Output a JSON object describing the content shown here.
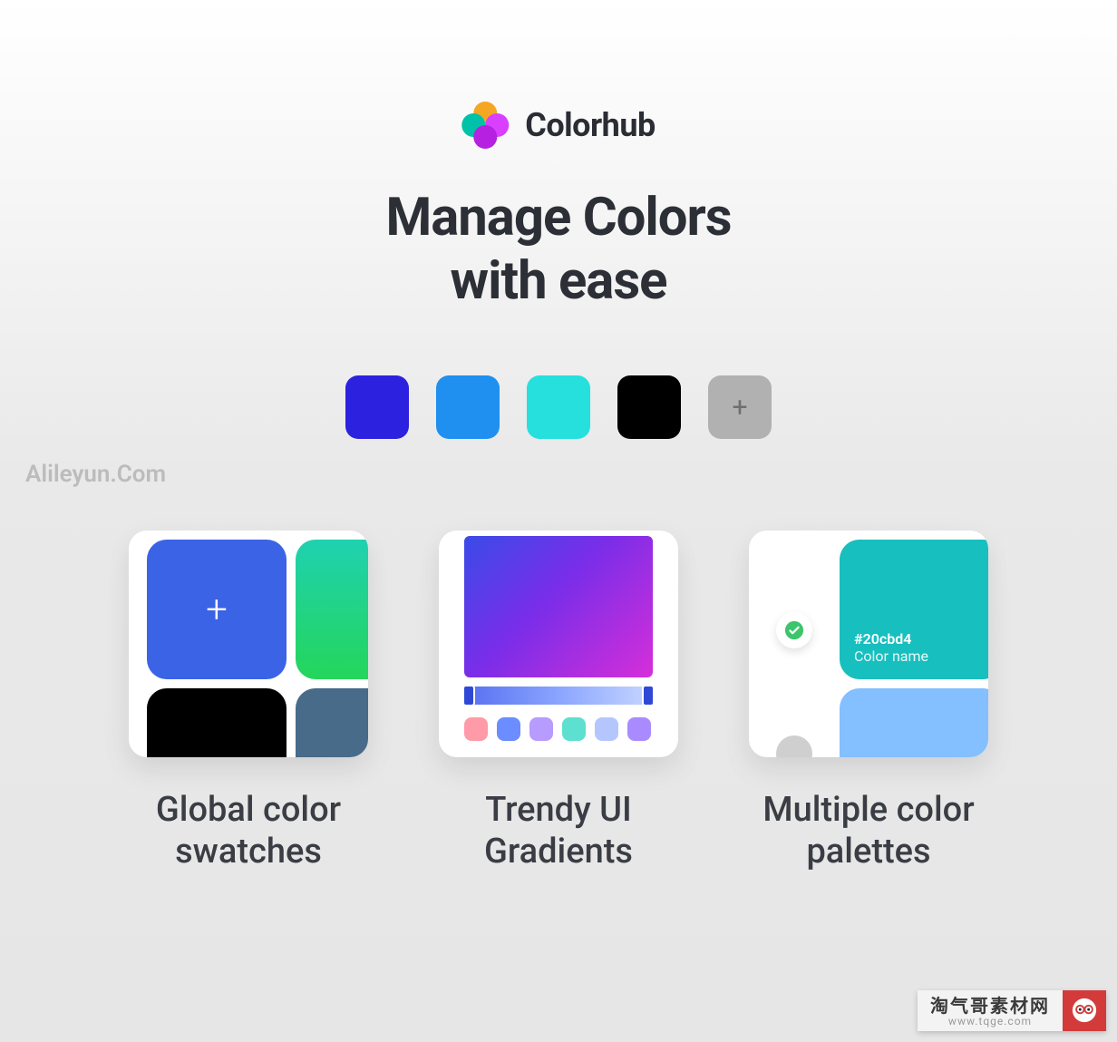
{
  "brand": {
    "name": "Colorhub",
    "logo_colors": {
      "top": "#f5a623",
      "left": "#00c2a8",
      "right": "#d83fff",
      "bottom": "#b620e0"
    }
  },
  "headline": "Manage Colors\nwith ease",
  "swatches": [
    {
      "color": "#2d21e0"
    },
    {
      "color": "#1f8ff0"
    },
    {
      "color": "#25e0dd"
    },
    {
      "color": "#000000"
    },
    {
      "add": true
    }
  ],
  "watermark_left": "Alileyun.Com",
  "features": [
    {
      "id": "global-swatches",
      "title": "Global color\nswatches",
      "preview": {
        "type": "swatch-grid",
        "tiles": [
          {
            "color": "#3b63e6",
            "plus": true
          },
          {
            "gradient": [
              "#1fd1b0",
              "#24d65a"
            ]
          },
          {
            "color": "#000000"
          },
          {
            "color": "#476b88"
          }
        ]
      }
    },
    {
      "id": "trendy-gradients",
      "title": "Trendy UI\nGradients",
      "preview": {
        "type": "gradient-editor",
        "gradient": [
          "#3a4be8",
          "#7b2de8",
          "#d62fd9"
        ],
        "slider": [
          "#566ff2",
          "#8aa5ff",
          "#c7d6ff"
        ],
        "chips": [
          "#ff9aa9",
          "#6b8dff",
          "#b79bff",
          "#5de0d0",
          "#b5c6ff",
          "#a98bff"
        ]
      }
    },
    {
      "id": "multiple-palettes",
      "title": "Multiple color\npalettes",
      "preview": {
        "type": "palette-list",
        "selected": {
          "hex": "#20cbd4",
          "label": "Color name"
        },
        "tiles": [
          "#17bfbf",
          "#6a8fff",
          "#84bfff",
          "#ff7be8"
        ],
        "check_color": "#3cc56b"
      }
    }
  ],
  "watermark_badge": {
    "line1": "淘气哥素材网",
    "line2": "www.tqge.com"
  }
}
